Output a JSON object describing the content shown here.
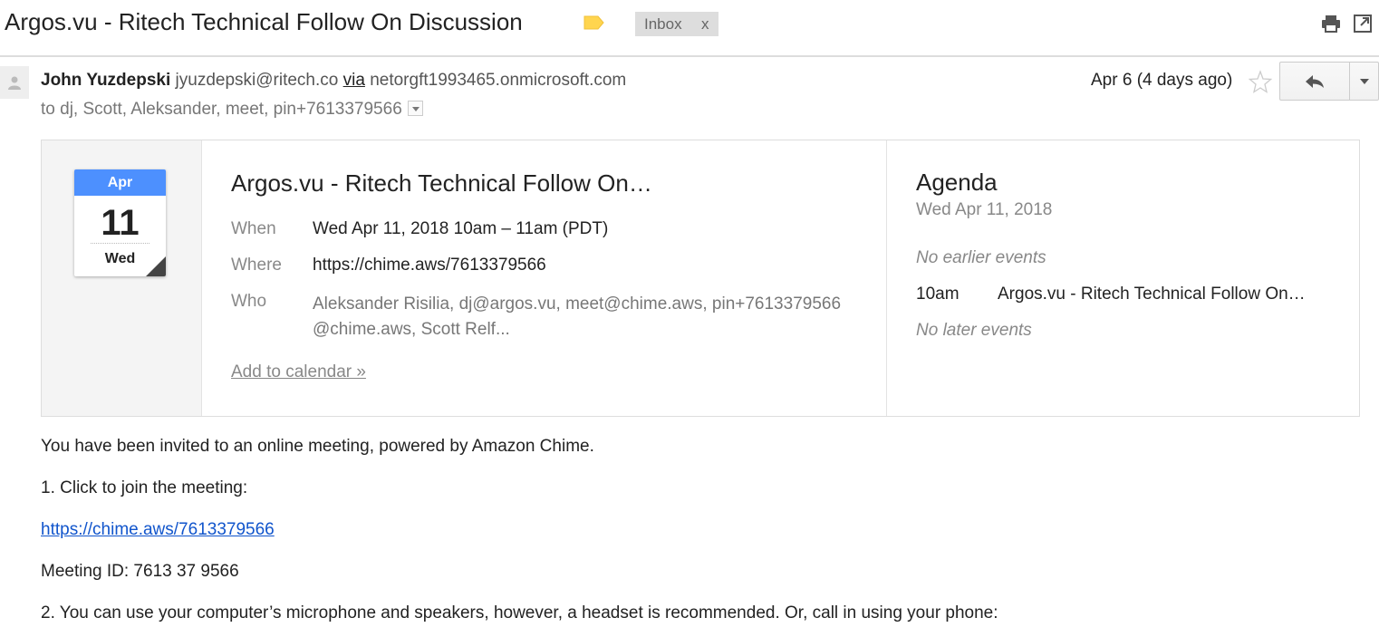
{
  "subject": "Argos.vu - Ritech Technical Follow On Discussion",
  "label": {
    "name": "Inbox",
    "close": "x",
    "tag_color": "#ffd54f"
  },
  "toolbar": {
    "print_icon": "print-icon",
    "new_window_icon": "new-window-icon"
  },
  "message": {
    "sender_name": "John Yuzdepski",
    "sender_email": "jyuzdepski@ritech.co",
    "via_label": "via",
    "via_domain": "netorgft1993465.onmicrosoft.com",
    "to_line": "to dj, Scott, Aleksander, meet, pin+7613379566",
    "date": "Apr 6 (4 days ago)"
  },
  "invite": {
    "cal_month": "Apr",
    "cal_day": "11",
    "cal_dow": "Wed",
    "title": "Argos.vu - Ritech Technical Follow On…",
    "when_label": "When",
    "when_value": "Wed Apr 11, 2018 10am – 11am (PDT)",
    "where_label": "Where",
    "where_value": "https://chime.aws/7613379566",
    "who_label": "Who",
    "who_value": "Aleksander Risilia, dj@argos.vu, meet@chime.aws, pin+7613379566@chime.aws, Scott Relf...",
    "add_calendar": "Add to calendar »"
  },
  "agenda": {
    "title": "Agenda",
    "date": "Wed Apr 11, 2018",
    "no_earlier": "No earlier events",
    "event_time": "10am",
    "event_title": "Argos.vu - Ritech Technical Follow On…",
    "no_later": "No later events"
  },
  "body": {
    "line1": "You have been invited to an online meeting, powered by Amazon Chime.",
    "line2": "1. Click to join the meeting:",
    "link": "https://chime.aws/7613379566",
    "line3": "Meeting ID: 7613 37 9566",
    "line4": "2. You can use your computer’s microphone and speakers, however, a headset is recommended. Or, call in using your phone:"
  },
  "colors": {
    "accent_blue": "#4d90fe",
    "link": "#1155cc"
  }
}
